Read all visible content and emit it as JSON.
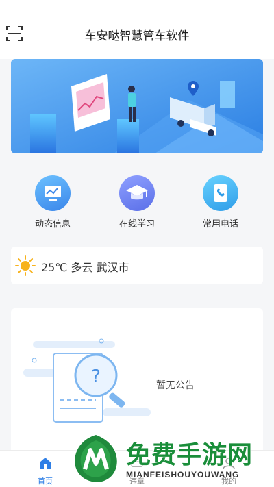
{
  "header": {
    "title": "车安哒智慧管车软件",
    "scan_icon": "scan-icon"
  },
  "banner": {
    "alt_icon": "truck-map-illustration"
  },
  "quick_actions": [
    {
      "label": "动态信息",
      "icon": "monitor-chart-icon",
      "color": "#4aa3f0"
    },
    {
      "label": "在线学习",
      "icon": "graduation-cap-icon",
      "color": "#6b7ff0"
    },
    {
      "label": "常用电话",
      "icon": "phone-book-icon",
      "color": "#3fb4f0"
    }
  ],
  "weather": {
    "icon": "sun-icon",
    "text": "25℃ 多云 武汉市"
  },
  "notice": {
    "empty_text": "暂无公告",
    "icon": "empty-search-illustration"
  },
  "tabbar": {
    "tabs": [
      {
        "label": "首页",
        "icon": "home-icon",
        "active": true
      },
      {
        "label": "违章",
        "icon": "car-icon",
        "active": false
      },
      {
        "label": "我的",
        "icon": "user-icon",
        "active": false
      }
    ]
  },
  "watermark": {
    "title": "免费手游网",
    "subtitle": "MIANFEISHOUYOUWANG"
  },
  "colors": {
    "accent": "#2f7fe6",
    "watermark_green": "#1a8e3a"
  }
}
